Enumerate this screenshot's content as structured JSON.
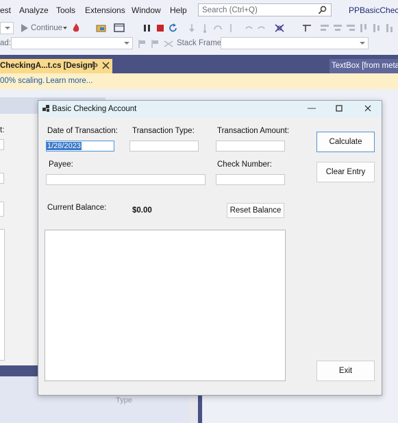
{
  "menu": {
    "items": [
      "est",
      "Analyze",
      "Tools",
      "Extensions",
      "Window",
      "Help"
    ],
    "search_placeholder": "Search (Ctrl+Q)",
    "project_name": "PPBasicChecki"
  },
  "toolbar": {
    "continue_label": "Continue",
    "frame_prefix": "ad:",
    "stack_frame_label": "Stack Frame:"
  },
  "tabs": {
    "design_tab": "CheckingA...t.cs [Design]",
    "right_tab": "TextBox [from metad"
  },
  "infobar": {
    "scaling_text": "00% scaling.",
    "learn_more": "Learn more..."
  },
  "designer": {
    "behind_fragment": "t:",
    "type_label": "Type"
  },
  "form": {
    "title": "Basic Checking Account",
    "labels": {
      "date": "Date of Transaction:",
      "type": "Transaction Type:",
      "amount": "Transaction Amount:",
      "payee": "Payee:",
      "check_number": "Check Number:",
      "current_balance": "Current Balance:",
      "balance_value": "$0.00"
    },
    "fields": {
      "date_value": "1/28/2023"
    },
    "buttons": {
      "calculate": "Calculate",
      "clear_entry": "Clear Entry",
      "reset_balance": "Reset Balance",
      "exit": "Exit"
    }
  },
  "colors": {
    "tab_strip": "#4a5284",
    "design_tab": "#f9d98a",
    "infobar": "#fdf0c8",
    "selection": "#3a79c8"
  }
}
